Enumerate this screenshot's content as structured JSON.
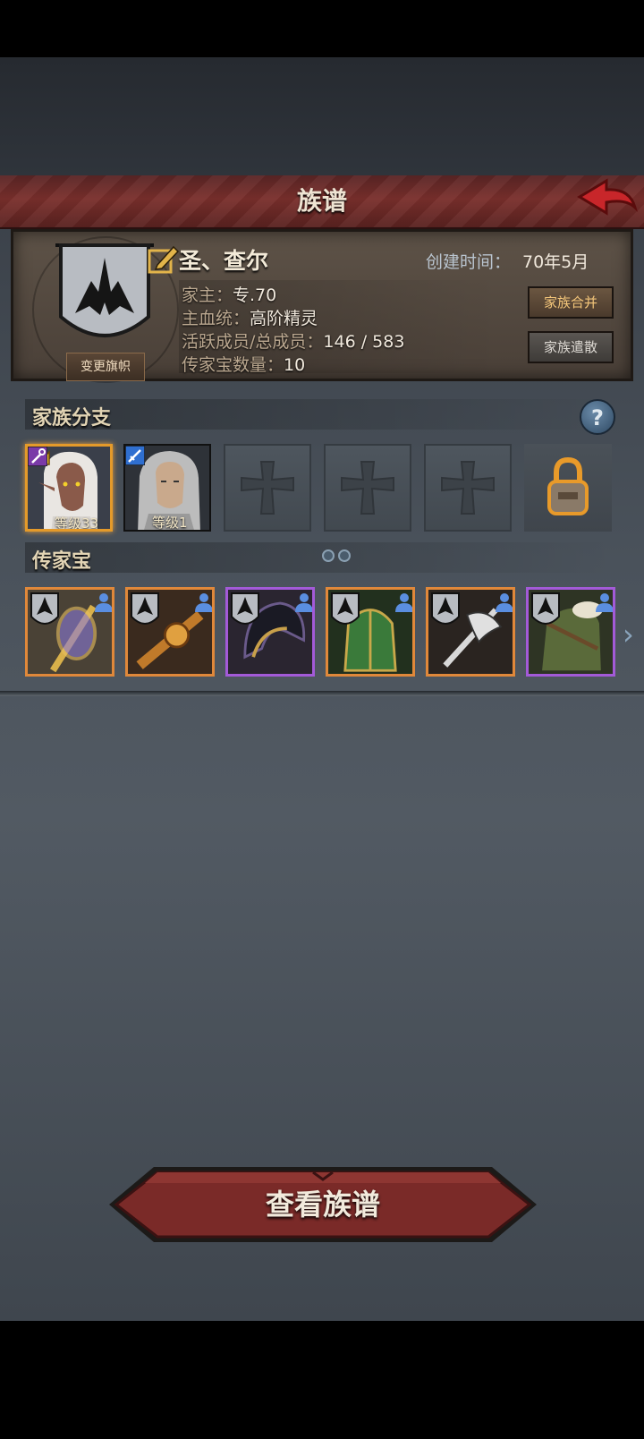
{
  "header": {
    "title": "族谱"
  },
  "family": {
    "name": "圣、查尔",
    "change_banner_label": "变更旗帜",
    "created_label": "创建时间：",
    "created_value": "70年5月",
    "rows": [
      {
        "label": "家主：",
        "value": "专.70"
      },
      {
        "label": "主血统：",
        "value": "高阶精灵"
      },
      {
        "label": "活跃成员/总成员：",
        "value": "146 / 583"
      },
      {
        "label": "传家宝数量：",
        "value": "10"
      }
    ],
    "merge_button": "家族合并",
    "disband_button": "家族遣散"
  },
  "branches": {
    "title": "家族分支",
    "help_symbol": "?",
    "members": [
      {
        "level_label": "等级33",
        "role": "mage-staff",
        "crowned": true
      },
      {
        "level_label": "等级1",
        "role": "sword",
        "crowned": false
      }
    ],
    "empty_slots": 3,
    "locked_slots": 1
  },
  "heirlooms": {
    "title": "传家宝",
    "items": [
      {
        "name": "golden-staff",
        "rarity": "orange"
      },
      {
        "name": "ornate-sword",
        "rarity": "orange"
      },
      {
        "name": "dark-helmet",
        "rarity": "purple"
      },
      {
        "name": "green-armor",
        "rarity": "orange"
      },
      {
        "name": "battle-axe",
        "rarity": "orange"
      },
      {
        "name": "fur-armor",
        "rarity": "purple"
      }
    ]
  },
  "main_button": {
    "label": "查看族谱"
  },
  "colors": {
    "header": "#7a2f2c",
    "orange_frame": "#e0883a",
    "purple_frame": "#a35ad8",
    "merge_text": "#f4c67a"
  }
}
